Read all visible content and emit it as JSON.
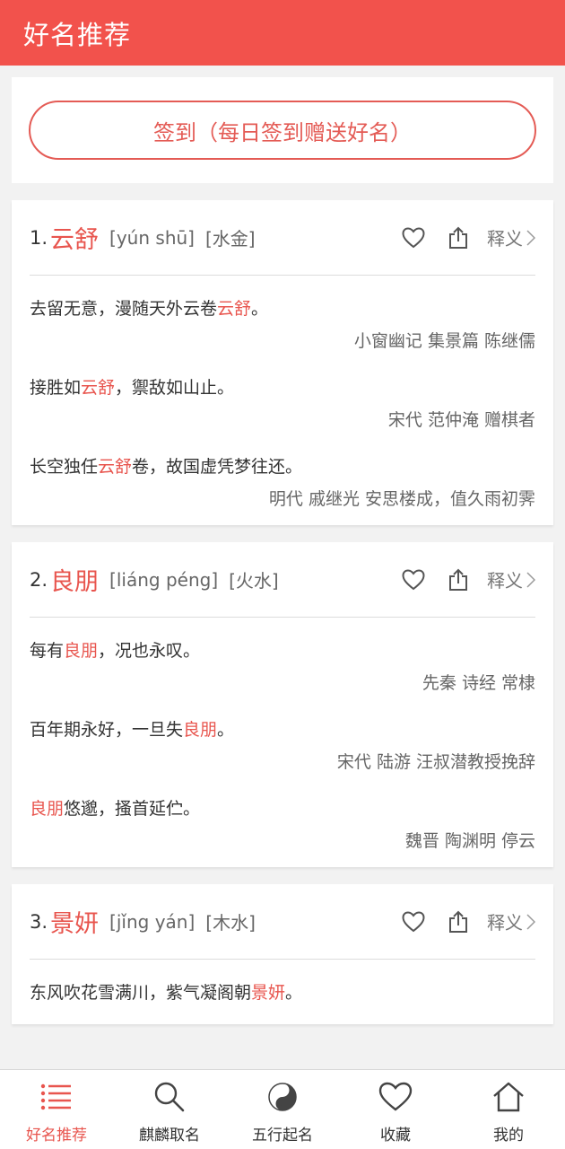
{
  "header": {
    "title": "好名推荐"
  },
  "checkin": {
    "label": "签到（每日签到赠送好名）"
  },
  "cards": [
    {
      "rank": "1.",
      "name": "云舒",
      "pinyin": "[yún shū]",
      "wuxing": "[水金]",
      "meaning_label": "释义",
      "verses": [
        {
          "pre": "去留无意，漫随天外云卷",
          "hl": "云舒",
          "post": "。",
          "source": "小窗幽记 集景篇 陈继儒"
        },
        {
          "pre": "接胜如",
          "hl": "云舒",
          "post": "，禦敌如山止。",
          "source": "宋代 范仲淹 赠棋者"
        },
        {
          "pre": "长空独任",
          "hl": "云舒",
          "post": "卷，故国虚凭梦往还。",
          "source": "明代 戚继光 安思楼成，值久雨初霁"
        }
      ]
    },
    {
      "rank": "2.",
      "name": "良朋",
      "pinyin": "[liáng péng]",
      "wuxing": "[火水]",
      "meaning_label": "释义",
      "verses": [
        {
          "pre": "每有",
          "hl": "良朋",
          "post": "，况也永叹。",
          "source": "先秦 诗经 常棣"
        },
        {
          "pre": "百年期永好，一旦失",
          "hl": "良朋",
          "post": "。",
          "source": "宋代 陆游 汪叔潜教授挽辞"
        },
        {
          "pre": "",
          "hl": "良朋",
          "post": "悠邈，搔首延伫。",
          "source": "魏晋 陶渊明 停云"
        }
      ]
    },
    {
      "rank": "3.",
      "name": "景妍",
      "pinyin": "[jǐng yán]",
      "wuxing": "[木水]",
      "meaning_label": "释义",
      "verses": [
        {
          "pre": "东风吹花雪满川，紫气凝阁朝",
          "hl": "景妍",
          "post": "。",
          "source": ""
        }
      ]
    }
  ],
  "tabbar": {
    "items": [
      {
        "label": "好名推荐",
        "icon": "list-icon",
        "active": true
      },
      {
        "label": "麒麟取名",
        "icon": "search-icon"
      },
      {
        "label": "五行起名",
        "icon": "yin-yang-icon"
      },
      {
        "label": "收藏",
        "icon": "heart-icon"
      },
      {
        "label": "我的",
        "icon": "home-icon"
      }
    ]
  },
  "colors": {
    "accent": "#f2524c",
    "highlight": "#e8554e"
  }
}
